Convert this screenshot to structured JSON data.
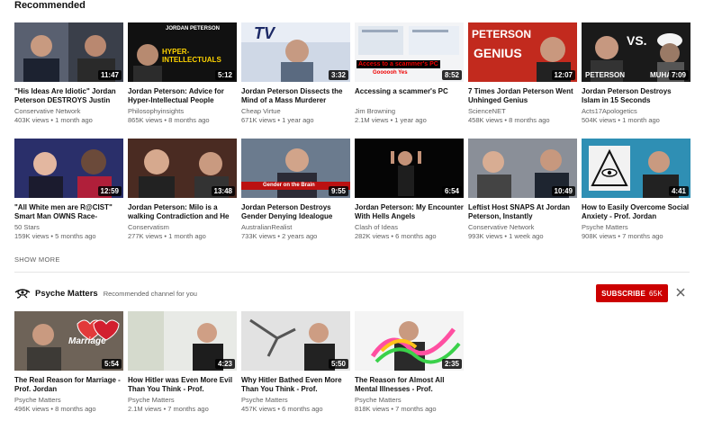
{
  "section_title": "Recommended",
  "row1": [
    {
      "title": "\"His Ideas Are Idiotic\" Jordan Peterson DESTROYS Justin",
      "channel": "Conservative Network",
      "meta": "403K views • 1 month ago",
      "duration": "11:47"
    },
    {
      "title": "Jordan Peterson: Advice for Hyper-Intellectual People",
      "channel": "Philosophyinsights",
      "meta": "865K views • 8 months ago",
      "duration": "5:12",
      "overlay_top": "JORDAN PETERSON",
      "overlay_main": "HYPER-INTELLECTUALS"
    },
    {
      "title": "Jordan Peterson Dissects the Mind of a Mass Murderer",
      "channel": "Cheap Virtue",
      "meta": "671K views • 1 year ago",
      "duration": "3:32",
      "overlay_main": "TV"
    },
    {
      "title": "Accessing a scammer's PC",
      "channel": "Jim Browning",
      "meta": "2.1M views • 1 year ago",
      "duration": "8:52",
      "overlay_main": "Access to a scammer's PC",
      "overlay_sub": "Goooooh Yes"
    },
    {
      "title": "7 Times Jordan Peterson Went Unhinged Genius",
      "channel": "ScienceNET",
      "meta": "458K views • 8 months ago",
      "duration": "12:07",
      "overlay_main": "PETERSON",
      "overlay_sub": "GENIUS"
    },
    {
      "title": "Jordan Peterson Destroys Islam in 15 Seconds",
      "channel": "Acts17Apologetics",
      "meta": "504K views • 1 month ago",
      "duration": "7:09",
      "overlay_main": "VS.",
      "overlay_left": "PETERSON",
      "overlay_right": "MUHAM"
    }
  ],
  "row2": [
    {
      "title": "\"All White men are R@CIST\" Smart Man OWNS Race-",
      "channel": "50 Stars",
      "meta": "159K views • 5 months ago",
      "duration": "12:59"
    },
    {
      "title": "Jordan Peterson: Milo is a walking Contradiction and He",
      "channel": "Conservatism",
      "meta": "277K views • 1 month ago",
      "duration": "13:48"
    },
    {
      "title": "Jordan Peterson Destroys Gender Denying Idealogue",
      "channel": "AustralianRealist",
      "meta": "733K views • 2 years ago",
      "duration": "9:55",
      "overlay_main": "Gender on the Brain"
    },
    {
      "title": "Jordan Peterson: My Encounter With Hells Angels",
      "channel": "Clash of Ideas",
      "meta": "282K views • 6 months ago",
      "duration": "6:54"
    },
    {
      "title": "Leftist Host SNAPS At Jordan Peterson, Instantly",
      "channel": "Conservative Network",
      "meta": "993K views • 1 week ago",
      "duration": "10:49"
    },
    {
      "title": "How to Easily Overcome Social Anxiety - Prof. Jordan",
      "channel": "Psyche Matters",
      "meta": "908K views • 7 months ago",
      "duration": "4:41"
    }
  ],
  "show_more": "SHOW MORE",
  "channel_shelf": {
    "name": "Psyche Matters",
    "subtitle": "Recommended channel for you",
    "subscribe_label": "SUBSCRIBE",
    "subscriber_count": "65K",
    "accent": "#cc0000"
  },
  "row3": [
    {
      "title": "The Real Reason for Marriage - Prof. Jordan",
      "channel": "Psyche Matters",
      "meta": "496K views • 8 months ago",
      "duration": "5:54",
      "overlay_main": "Marriage"
    },
    {
      "title": "How Hitler was Even More Evil Than You Think - Prof.",
      "channel": "Psyche Matters",
      "meta": "2.1M views • 7 months ago",
      "duration": "4:23"
    },
    {
      "title": "Why Hitler Bathed Even More Than You Think - Prof.",
      "channel": "Psyche Matters",
      "meta": "457K views • 6 months ago",
      "duration": "5:50"
    },
    {
      "title": "The Reason for Almost All Mental Illnesses - Prof.",
      "channel": "Psyche Matters",
      "meta": "818K views • 7 months ago",
      "duration": "2:35"
    }
  ]
}
